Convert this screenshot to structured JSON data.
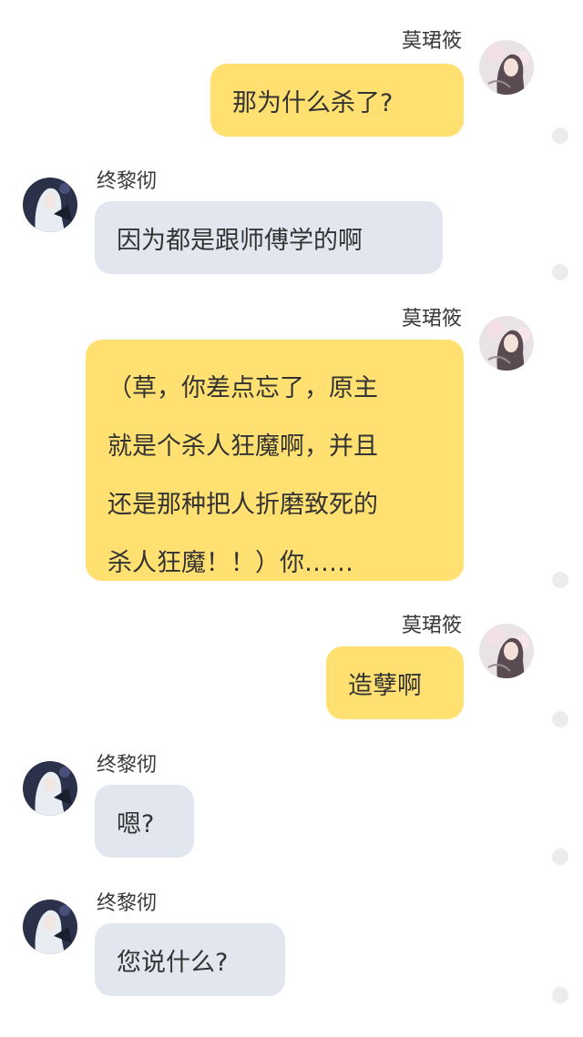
{
  "chat": {
    "messages": [
      {
        "sender": "莫珺筱",
        "side": "right",
        "avatar": "girl-avatar-icon",
        "lines": [
          "那为什么杀了?"
        ]
      },
      {
        "sender": "终黎彻",
        "side": "left",
        "avatar": "white-hair-avatar-icon",
        "lines": [
          "因为都是跟师傅学的啊"
        ]
      },
      {
        "sender": "莫珺筱",
        "side": "right",
        "avatar": "girl-avatar-icon",
        "lines": [
          "（草，你差点忘了，原主",
          "就是个杀人狂魔啊，并且",
          "还是那种把人折磨致死的",
          "杀人狂魔！！）你……"
        ]
      },
      {
        "sender": "莫珺筱",
        "side": "right",
        "avatar": "girl-avatar-icon",
        "lines": [
          "造孽啊"
        ]
      },
      {
        "sender": "终黎彻",
        "side": "left",
        "avatar": "white-hair-avatar-icon",
        "lines": [
          "嗯?"
        ]
      },
      {
        "sender": "终黎彻",
        "side": "left",
        "avatar": "white-hair-avatar-icon",
        "lines": [
          "您说什么?"
        ]
      }
    ]
  },
  "colors": {
    "my_bubble": "#ffe071",
    "other_bubble": "#e2e7ef",
    "status_dot": "#ececec"
  }
}
